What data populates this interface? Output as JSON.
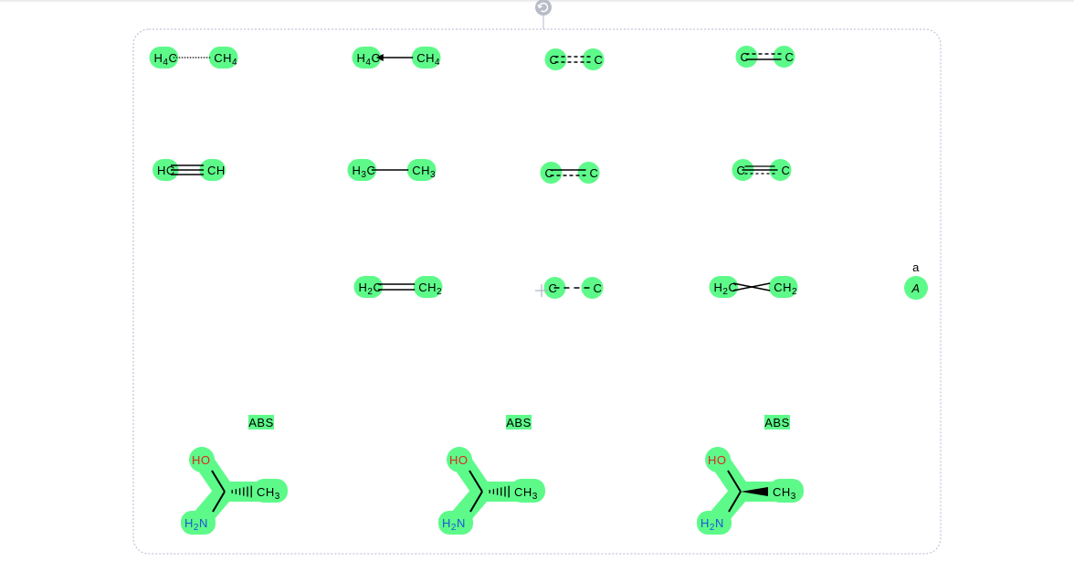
{
  "canvas": {
    "selection_box": {
      "border_color": "#b7b7d4"
    },
    "rotate_handle": {
      "icon": "rotate-icon",
      "color": "#b8bcc9"
    },
    "highlight_color": "#5dfa8a"
  },
  "molecules": [
    {
      "id": "hydrogen-bond",
      "left": [
        "H",
        "4",
        "C"
      ],
      "right": [
        "CH",
        "4",
        ""
      ],
      "bond": "dotted"
    },
    {
      "id": "dative",
      "left": [
        "H",
        "4",
        "C"
      ],
      "right": [
        "CH",
        "4",
        ""
      ],
      "bond": "dative"
    },
    {
      "id": "aromatic-single",
      "left": [
        "C",
        "",
        ""
      ],
      "right": [
        "C",
        "",
        ""
      ],
      "bond": "dash-double-top"
    },
    {
      "id": "aromatic-double",
      "left": [
        "C",
        "",
        ""
      ],
      "right": [
        "C",
        "",
        ""
      ],
      "bond": "dash-double-bottom"
    },
    {
      "id": "triple",
      "left": [
        "HC",
        "",
        ""
      ],
      "right": [
        "CH",
        "",
        ""
      ],
      "bond": "triple"
    },
    {
      "id": "single",
      "left": [
        "H",
        "3",
        "C"
      ],
      "right": [
        "CH",
        "3",
        ""
      ],
      "bond": "single"
    },
    {
      "id": "single-or-double",
      "left": [
        "C",
        "",
        ""
      ],
      "right": [
        "C",
        "",
        ""
      ],
      "bond": "single-or-double"
    },
    {
      "id": "single-or-aromatic",
      "left": [
        "C",
        "",
        ""
      ],
      "right": [
        "C",
        "",
        ""
      ],
      "bond": "single-or-aromatic"
    },
    {
      "id": "double",
      "left": [
        "H",
        "2",
        "C"
      ],
      "right": [
        "CH",
        "2",
        ""
      ],
      "bond": "double"
    },
    {
      "id": "any",
      "left": [
        "C",
        "",
        ""
      ],
      "right": [
        "C",
        "",
        ""
      ],
      "bond": "any"
    },
    {
      "id": "crossed",
      "left": [
        "H",
        "2",
        "C"
      ],
      "right": [
        "CH",
        "2",
        ""
      ],
      "bond": "crossed"
    }
  ],
  "pseudo_atom": {
    "label": "A",
    "annotation": "a"
  },
  "stereo": [
    {
      "flag": "ABS",
      "oh": "HO",
      "me": [
        "CH",
        "3"
      ],
      "nh": [
        "H",
        "2",
        "N"
      ],
      "wedge": "hash-up"
    },
    {
      "flag": "ABS",
      "oh": "HO",
      "me": [
        "CH",
        "3"
      ],
      "nh": [
        "H",
        "2",
        "N"
      ],
      "wedge": "hash"
    },
    {
      "flag": "ABS",
      "oh": "HO",
      "me": [
        "CH",
        "3"
      ],
      "nh": [
        "H",
        "2",
        "N"
      ],
      "wedge": "wedge"
    }
  ]
}
